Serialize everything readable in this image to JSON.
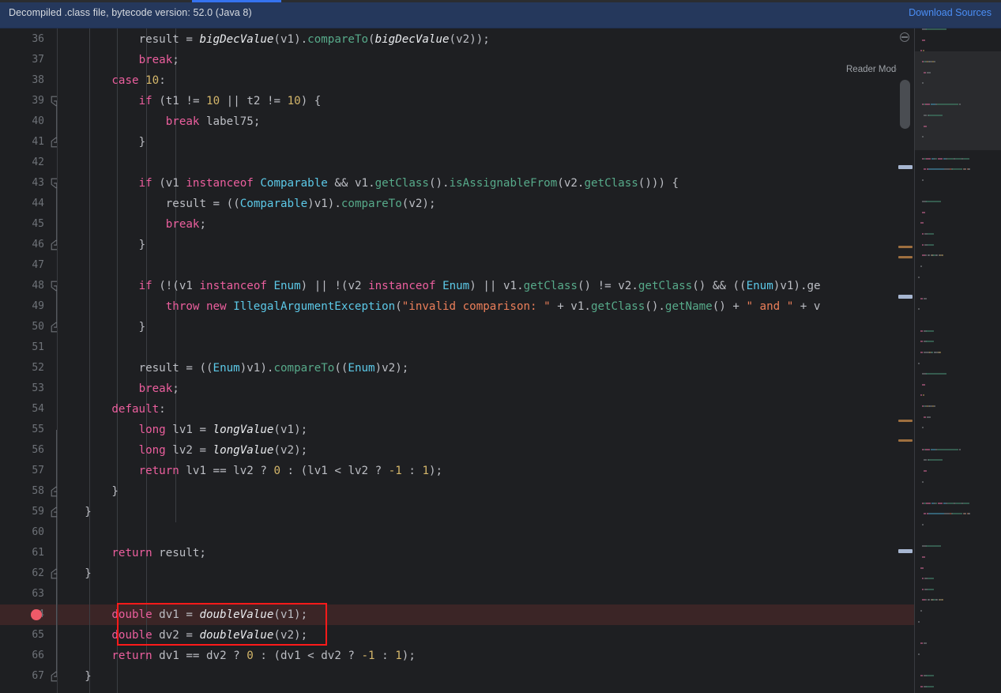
{
  "banner": {
    "message": "Decompiled .class file, bytecode version: 52.0 (Java 8)",
    "action_label": "Download Sources",
    "background": "#25385c",
    "link_color": "#4b8ef5"
  },
  "editor": {
    "reader_mode_label": "Reader Mode",
    "background": "#1e1f22",
    "first_visible_line": 36,
    "last_visible_line": 67,
    "breakpoint_line": 64,
    "highlighted_line": 64,
    "annotation": {
      "color": "#ff1a1a",
      "from_line": 64,
      "to_line": 65
    },
    "line_numbers": [
      36,
      37,
      38,
      39,
      40,
      41,
      42,
      43,
      44,
      45,
      46,
      47,
      48,
      49,
      50,
      51,
      52,
      53,
      54,
      55,
      56,
      57,
      58,
      59,
      60,
      61,
      62,
      63,
      64,
      65,
      66,
      67
    ],
    "fold_markers": [
      {
        "line": 39,
        "type": "collapse-start"
      },
      {
        "line": 41,
        "type": "collapse-end"
      },
      {
        "line": 43,
        "type": "collapse-start"
      },
      {
        "line": 46,
        "type": "collapse-end"
      },
      {
        "line": 48,
        "type": "collapse-start"
      },
      {
        "line": 50,
        "type": "collapse-end"
      },
      {
        "line": 58,
        "type": "collapse-end"
      },
      {
        "line": 59,
        "type": "collapse-end"
      },
      {
        "line": 62,
        "type": "collapse-end"
      },
      {
        "line": 67,
        "type": "collapse-end"
      }
    ],
    "syntax_colors": {
      "keyword": "#ec5f9e",
      "type": "#5cc9e8",
      "method": "#57aa8a",
      "static_method": "#e9ebee",
      "number": "#d4b66a",
      "string": "#ec7f5a",
      "plain": "#bcbec4",
      "line_number": "#6e7278"
    },
    "code_lines": [
      {
        "n": 36,
        "indent": 0,
        "text": "            result = bigDecValue(v1).compareTo(bigDecValue(v2));"
      },
      {
        "n": 37,
        "indent": 0,
        "text": "            break;"
      },
      {
        "n": 38,
        "indent": 0,
        "text": "        case 10:"
      },
      {
        "n": 39,
        "indent": 0,
        "text": "            if (t1 != 10 || t2 != 10) {"
      },
      {
        "n": 40,
        "indent": 0,
        "text": "                break label75;"
      },
      {
        "n": 41,
        "indent": 0,
        "text": "            }"
      },
      {
        "n": 42,
        "indent": 0,
        "text": ""
      },
      {
        "n": 43,
        "indent": 0,
        "text": "            if (v1 instanceof Comparable && v1.getClass().isAssignableFrom(v2.getClass())) {"
      },
      {
        "n": 44,
        "indent": 0,
        "text": "                result = ((Comparable)v1).compareTo(v2);"
      },
      {
        "n": 45,
        "indent": 0,
        "text": "                break;"
      },
      {
        "n": 46,
        "indent": 0,
        "text": "            }"
      },
      {
        "n": 47,
        "indent": 0,
        "text": ""
      },
      {
        "n": 48,
        "indent": 0,
        "text": "            if (!(v1 instanceof Enum) || !(v2 instanceof Enum) || v1.getClass() != v2.getClass() && ((Enum)v1).ge"
      },
      {
        "n": 49,
        "indent": 0,
        "text": "                throw new IllegalArgumentException(\"invalid comparison: \" + v1.getClass().getName() + \" and \" + v"
      },
      {
        "n": 50,
        "indent": 0,
        "text": "            }"
      },
      {
        "n": 51,
        "indent": 0,
        "text": ""
      },
      {
        "n": 52,
        "indent": 0,
        "text": "            result = ((Enum)v1).compareTo((Enum)v2);"
      },
      {
        "n": 53,
        "indent": 0,
        "text": "            break;"
      },
      {
        "n": 54,
        "indent": 0,
        "text": "        default:"
      },
      {
        "n": 55,
        "indent": 0,
        "text": "            long lv1 = longValue(v1);"
      },
      {
        "n": 56,
        "indent": 0,
        "text": "            long lv2 = longValue(v2);"
      },
      {
        "n": 57,
        "indent": 0,
        "text": "            return lv1 == lv2 ? 0 : (lv1 < lv2 ? -1 : 1);"
      },
      {
        "n": 58,
        "indent": 0,
        "text": "        }"
      },
      {
        "n": 59,
        "indent": 0,
        "text": "    }"
      },
      {
        "n": 60,
        "indent": 0,
        "text": ""
      },
      {
        "n": 61,
        "indent": 0,
        "text": "        return result;"
      },
      {
        "n": 62,
        "indent": 0,
        "text": "    }"
      },
      {
        "n": 63,
        "indent": 0,
        "text": ""
      },
      {
        "n": 64,
        "indent": 0,
        "text": "        double dv1 = doubleValue(v1);"
      },
      {
        "n": 65,
        "indent": 0,
        "text": "        double dv2 = doubleValue(v2);"
      },
      {
        "n": 66,
        "indent": 0,
        "text": "        return dv1 == dv2 ? 0 : (dv1 < dv2 ? -1 : 1);"
      },
      {
        "n": 67,
        "indent": 0,
        "text": "    }"
      }
    ]
  },
  "scrollbar": {
    "thumb_color": "#4a4d52",
    "warning_marks": [
      275,
      288,
      495,
      520
    ],
    "info_marks": [
      173,
      337,
      659
    ]
  }
}
